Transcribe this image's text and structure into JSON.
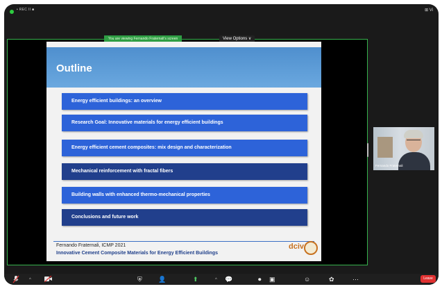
{
  "top_bar": {
    "rec_label": "• REC II ■",
    "right_label": "⊞ Vi"
  },
  "screen_share": {
    "banner_text": "You are viewing Fernando Fraternali's screen",
    "view_options_label": "View Options ∨"
  },
  "slide": {
    "title": "Outline",
    "items": [
      {
        "label": "Energy efficient buildings: an overview"
      },
      {
        "label": "Research Goal: Innovative materials for energy efficient buildings"
      },
      {
        "label": "Energy efficient cement composites: mix design and characterization"
      },
      {
        "label": "Mechanical reinforcement with fractal fibers"
      },
      {
        "label": "Building walls with enhanced thermo-mechanical properties"
      },
      {
        "label": "Conclusions and future work"
      }
    ],
    "footer_author": "Fernando Fraternali, ICMP 2021",
    "footer_title": "Innovative Cement Composite Materials for Energy Efficient Buildings",
    "logo_text": "dciv"
  },
  "participant": {
    "name": "Fernando Fraternali"
  },
  "toolbar": {
    "leave_label": "Leave"
  },
  "colors": {
    "accent_green": "#37b24d",
    "slide_blue": "#2d63d9",
    "leave_red": "#e03131"
  }
}
